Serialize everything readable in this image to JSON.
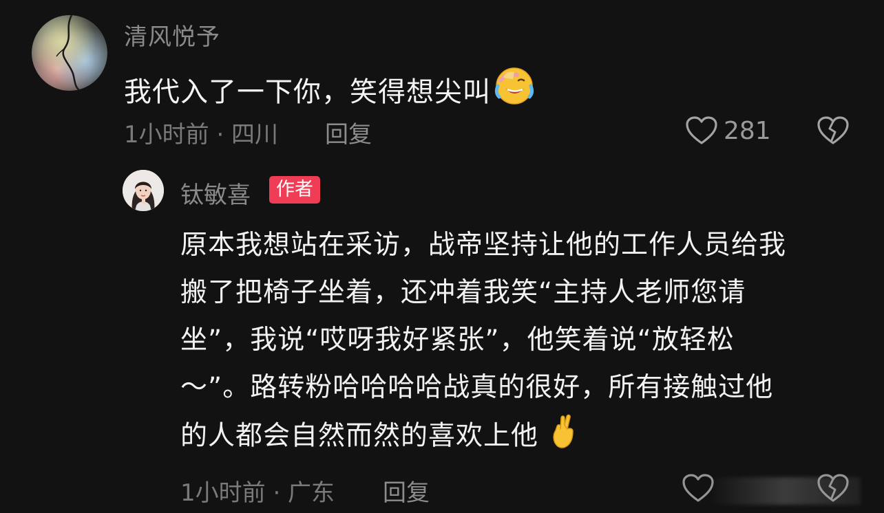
{
  "comment": {
    "username": "清风悦予",
    "text": "我代入了一下你，笑得想尖叫",
    "emoji_icon": "laughing-crying-face-icon",
    "meta": "1小时前 · 四川",
    "reply_label": "回复",
    "likes": "281"
  },
  "reply": {
    "username": "钛敏喜",
    "badge": "作者",
    "lines": [
      "原本我想站在采访，战帝坚持让他的工作人员给我",
      "搬了把椅子坐着，还冲着我笑“主持人老师您请",
      "坐”，我说“哎呀我好紧张”，他笑着说“放轻松",
      "～”。路转粉哈哈哈哈战真的很好，所有接触过他",
      "的人都会自然而然的喜欢上他"
    ],
    "emoji_icon": "crossed-fingers-icon",
    "meta": "1小时前 · 广东",
    "reply_label": "回复"
  },
  "colors": {
    "background": "#121212",
    "badge": "#f03c55",
    "muted_text": "#8a8a8a"
  }
}
